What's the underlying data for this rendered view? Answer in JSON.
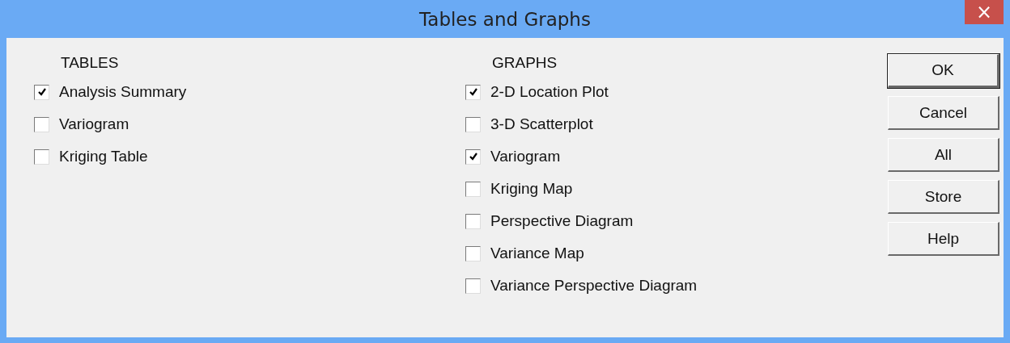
{
  "window": {
    "title": "Tables and Graphs",
    "close": "×"
  },
  "tables": {
    "heading": "TABLES",
    "items": [
      {
        "label": "Analysis Summary",
        "checked": true
      },
      {
        "label": "Variogram",
        "checked": false
      },
      {
        "label": "Kriging Table",
        "checked": false
      }
    ]
  },
  "graphs": {
    "heading": "GRAPHS",
    "items": [
      {
        "label": "2-D Location Plot",
        "checked": true
      },
      {
        "label": "3-D Scatterplot",
        "checked": false
      },
      {
        "label": "Variogram",
        "checked": true
      },
      {
        "label": "Kriging Map",
        "checked": false
      },
      {
        "label": "Perspective Diagram",
        "checked": false
      },
      {
        "label": "Variance Map",
        "checked": false
      },
      {
        "label": "Variance Perspective Diagram",
        "checked": false
      }
    ]
  },
  "buttons": [
    {
      "label": "OK",
      "default": true
    },
    {
      "label": "Cancel",
      "default": false
    },
    {
      "label": "All",
      "default": false
    },
    {
      "label": "Store",
      "default": false
    },
    {
      "label": "Help",
      "default": false
    }
  ]
}
